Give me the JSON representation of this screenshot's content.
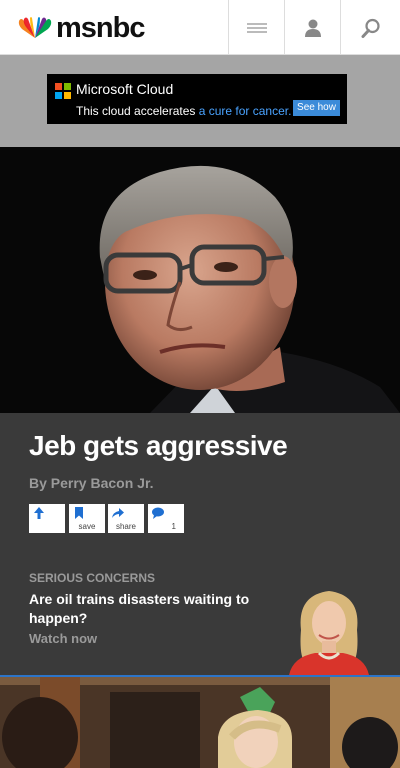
{
  "header": {
    "logo_text": "msnbc",
    "logo_icon": "peacock-icon",
    "menu_icon": "hamburger-icon",
    "user_icon": "user-icon",
    "search_icon": "search-icon"
  },
  "ad": {
    "brand": "Microsoft Cloud",
    "line_start": "This cloud accelerates",
    "line_highlight": " a cure for cancer.",
    "cta": "See how",
    "colors": {
      "red": "#f25022",
      "green": "#7fba00",
      "blue": "#00a4ef",
      "yellow": "#ffb900",
      "cta": "#3b8bd9"
    }
  },
  "story": {
    "headline": "Jeb gets aggressive",
    "byline": "By Perry Bacon Jr.",
    "actions": [
      {
        "icon": "upvote-arrow-icon",
        "label": ""
      },
      {
        "icon": "bookmark-icon",
        "label": "save"
      },
      {
        "icon": "share-arrow-icon",
        "label": "share"
      },
      {
        "icon": "comment-icon",
        "label": "1"
      }
    ]
  },
  "promo": {
    "kicker": "SERIOUS CONCERNS",
    "title": "Are oil trains disasters waiting to happen?",
    "cta": "Watch now"
  },
  "theme": {
    "accent_blue": "#2c74c8",
    "panel": "#3a3a3a"
  }
}
